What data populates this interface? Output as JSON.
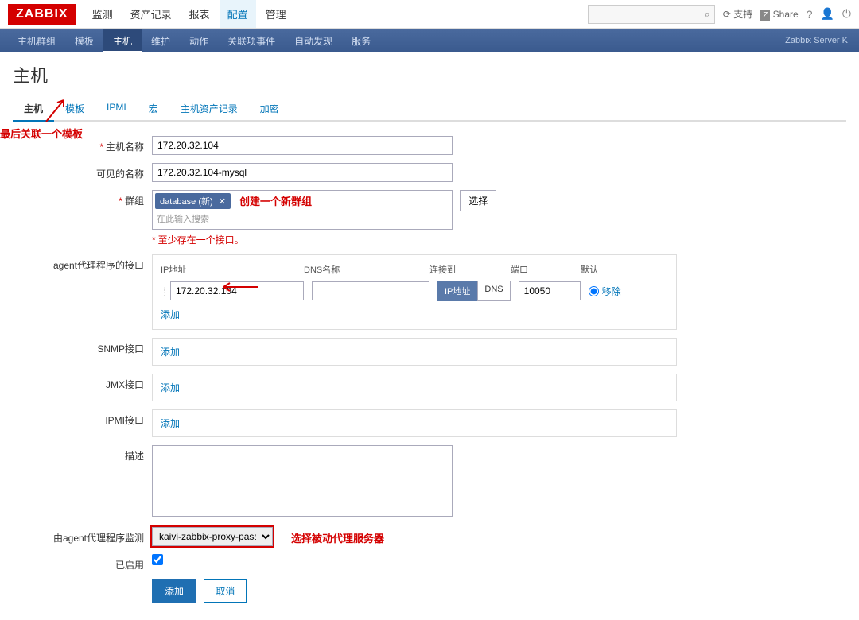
{
  "logo": "ZABBIX",
  "topnav": [
    "监测",
    "资产记录",
    "报表",
    "配置",
    "管理"
  ],
  "topnav_active": 3,
  "topright": {
    "support": "支持",
    "share": "Share",
    "help": "?"
  },
  "subnav": [
    "主机群组",
    "模板",
    "主机",
    "维护",
    "动作",
    "关联项事件",
    "自动发现",
    "服务"
  ],
  "subnav_active": 2,
  "subnav_right": "Zabbix Server K",
  "page_title": "主机",
  "tabs": [
    "主机",
    "模板",
    "IPMI",
    "宏",
    "主机资产记录",
    "加密"
  ],
  "tab_active": 0,
  "form": {
    "host_name_label": "主机名称",
    "host_name_value": "172.20.32.104",
    "visible_name_label": "可见的名称",
    "visible_name_value": "172.20.32.104-mysql",
    "groups_label": "群组",
    "groups_chip": "database (新)",
    "groups_placeholder": "在此输入搜索",
    "select_btn": "选择",
    "interface_error": "至少存在一个接口。",
    "agent_if_label": "agent代理程序的接口",
    "headers": {
      "ip": "IP地址",
      "dns": "DNS名称",
      "conn": "连接到",
      "port": "端口",
      "def": "默认"
    },
    "agent_row": {
      "ip": "172.20.32.104",
      "dns": "",
      "conn_ip": "IP地址",
      "conn_dns": "DNS",
      "port": "10050",
      "remove": "移除"
    },
    "add_link": "添加",
    "snmp_label": "SNMP接口",
    "jmx_label": "JMX接口",
    "ipmi_label": "IPMI接口",
    "desc_label": "描述",
    "proxy_label": "由agent代理程序监测",
    "proxy_value": "kaivi-zabbix-proxy-passive",
    "enabled_label": "已启用",
    "submit": "添加",
    "cancel": "取消"
  },
  "annotations": {
    "tmpl": "最后关联一个模板",
    "group": "创建一个新群组",
    "proxy": "选择被动代理服务器"
  }
}
